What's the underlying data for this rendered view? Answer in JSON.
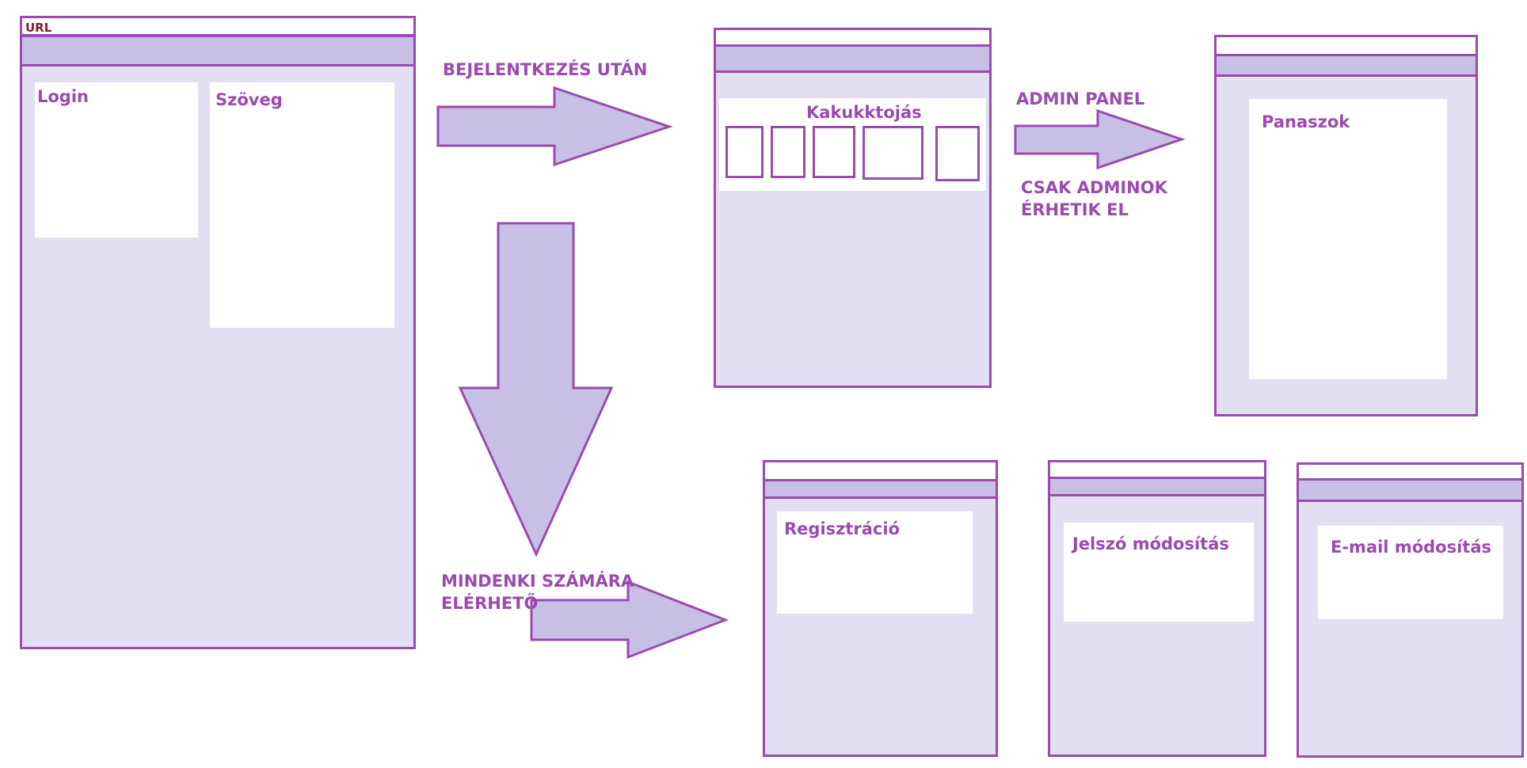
{
  "colors": {
    "outline": "#9B4AB0",
    "page_fill": "#E3DFF2",
    "bar_fill": "#C8BFE6",
    "panel_fill": "#FFFFFF",
    "url_text": "#8B1A2E"
  },
  "main_page": {
    "url_label": "URL",
    "login_label": "Login",
    "text_label": "Szöveg"
  },
  "flow_labels": {
    "after_login": "BEJELENTKEZÉS UTÁN",
    "admin_panel": "ADMIN PANEL",
    "admin_only_line1": "CSAK ADMINOK",
    "admin_only_line2": "ÉRHETIK EL",
    "everyone_line1": "MINDENKI SZÁMÁRA",
    "everyone_line2": "ELÉRHETŐ"
  },
  "kakukk_page": {
    "title": "Kakukktojás"
  },
  "admin_page": {
    "title": "Panaszok"
  },
  "public_pages": {
    "registration": "Regisztráció",
    "password_change": "Jelszó módosítás",
    "email_change": "E-mail módosítás"
  }
}
